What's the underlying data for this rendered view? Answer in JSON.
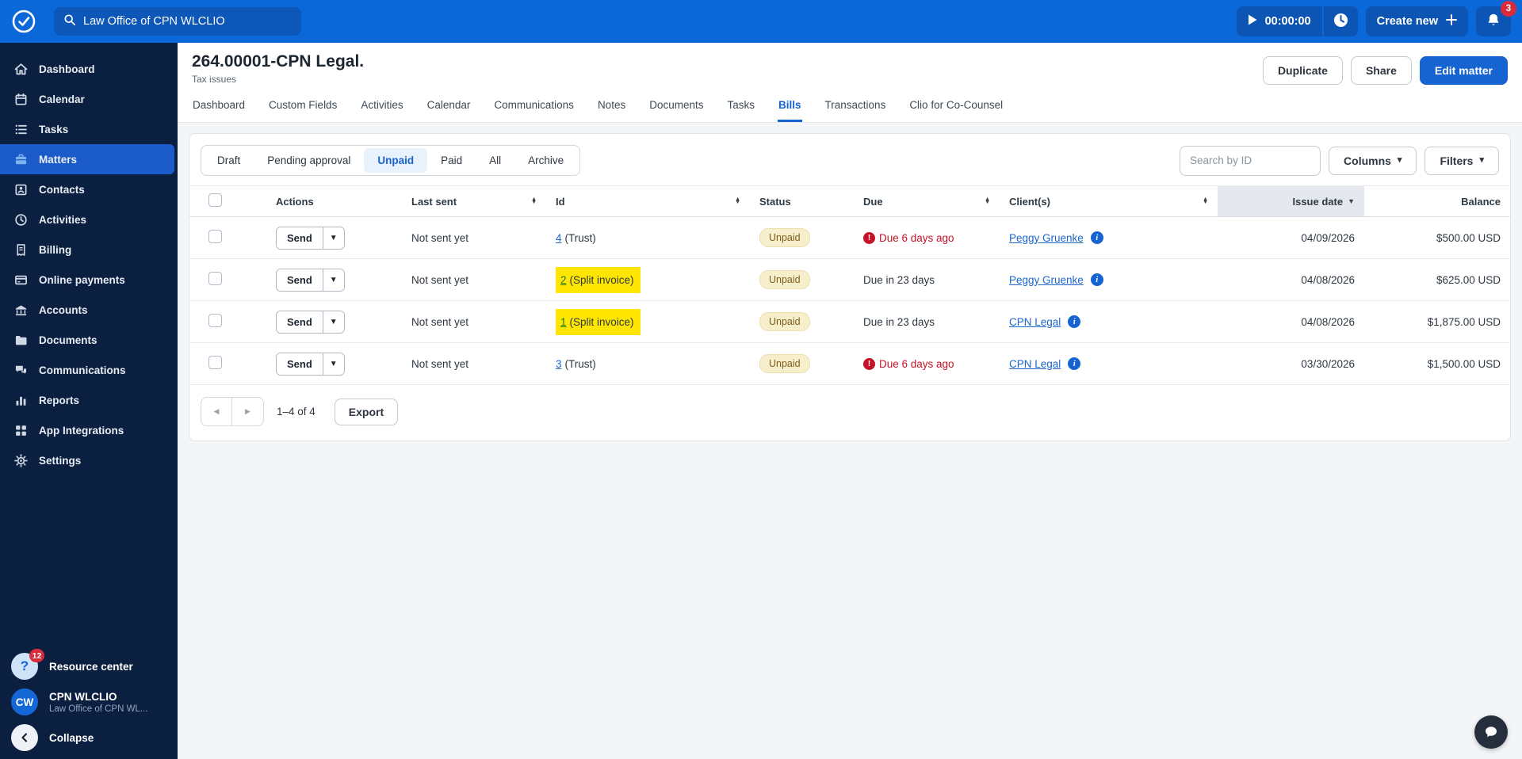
{
  "topbar": {
    "search_value": "Law Office of CPN WLCLIO",
    "timer": "00:00:00",
    "create_new_label": "Create new",
    "notification_count": "3"
  },
  "sidebar": {
    "items": [
      {
        "label": "Dashboard",
        "icon": "home-icon",
        "active": false
      },
      {
        "label": "Calendar",
        "icon": "calendar-icon",
        "active": false
      },
      {
        "label": "Tasks",
        "icon": "tasks-icon",
        "active": false
      },
      {
        "label": "Matters",
        "icon": "briefcase-icon",
        "active": true
      },
      {
        "label": "Contacts",
        "icon": "contact-card-icon",
        "active": false
      },
      {
        "label": "Activities",
        "icon": "clock-icon",
        "active": false
      },
      {
        "label": "Billing",
        "icon": "receipt-icon",
        "active": false
      },
      {
        "label": "Online payments",
        "icon": "credit-card-icon",
        "active": false
      },
      {
        "label": "Accounts",
        "icon": "bank-icon",
        "active": false
      },
      {
        "label": "Documents",
        "icon": "folder-icon",
        "active": false
      },
      {
        "label": "Communications",
        "icon": "chat-bubbles-icon",
        "active": false
      },
      {
        "label": "Reports",
        "icon": "bar-chart-icon",
        "active": false
      },
      {
        "label": "App Integrations",
        "icon": "apps-grid-icon",
        "active": false
      },
      {
        "label": "Settings",
        "icon": "gear-icon",
        "active": false
      }
    ],
    "resource_center": {
      "label": "Resource center",
      "badge": "12"
    },
    "user": {
      "initials": "CW",
      "name": "CPN WLCLIO",
      "org": "Law Office of CPN WL..."
    },
    "collapse_label": "Collapse"
  },
  "matter_header": {
    "title": "264.00001-CPN Legal.",
    "subtitle": "Tax issues",
    "duplicate_label": "Duplicate",
    "share_label": "Share",
    "edit_label": "Edit matter"
  },
  "tabs": [
    {
      "label": "Dashboard",
      "active": false
    },
    {
      "label": "Custom Fields",
      "active": false
    },
    {
      "label": "Activities",
      "active": false
    },
    {
      "label": "Calendar",
      "active": false
    },
    {
      "label": "Communications",
      "active": false
    },
    {
      "label": "Notes",
      "active": false
    },
    {
      "label": "Documents",
      "active": false
    },
    {
      "label": "Tasks",
      "active": false
    },
    {
      "label": "Bills",
      "active": true
    },
    {
      "label": "Transactions",
      "active": false
    },
    {
      "label": "Clio for Co-Counsel",
      "active": false
    }
  ],
  "bills": {
    "filters": [
      "Draft",
      "Pending approval",
      "Unpaid",
      "Paid",
      "All",
      "Archive"
    ],
    "active_filter": "Unpaid",
    "search_placeholder": "Search by ID",
    "columns_label": "Columns",
    "filters_label": "Filters",
    "table": {
      "headers": [
        "Actions",
        "Last sent",
        "Id",
        "Status",
        "Due",
        "Client(s)",
        "Issue date",
        "Balance"
      ],
      "sorted_column": "Issue date",
      "rows": [
        {
          "action": "Send",
          "last_sent": "Not sent yet",
          "id_link": "4",
          "id_suffix": "(Trust)",
          "highlighted": false,
          "status": "Unpaid",
          "due": "Due 6 days ago",
          "overdue": true,
          "client": "Peggy Gruenke",
          "issue_date": "04/09/2026",
          "balance": "$500.00 USD"
        },
        {
          "action": "Send",
          "last_sent": "Not sent yet",
          "id_link": "2",
          "id_suffix": "(Split invoice)",
          "highlighted": true,
          "status": "Unpaid",
          "due": "Due in 23 days",
          "overdue": false,
          "client": "Peggy Gruenke",
          "issue_date": "04/08/2026",
          "balance": "$625.00 USD"
        },
        {
          "action": "Send",
          "last_sent": "Not sent yet",
          "id_link": "1",
          "id_suffix": "(Split invoice)",
          "highlighted": true,
          "status": "Unpaid",
          "due": "Due in 23 days",
          "overdue": false,
          "client": "CPN Legal",
          "issue_date": "04/08/2026",
          "balance": "$1,875.00 USD"
        },
        {
          "action": "Send",
          "last_sent": "Not sent yet",
          "id_link": "3",
          "id_suffix": "(Trust)",
          "highlighted": false,
          "status": "Unpaid",
          "due": "Due 6 days ago",
          "overdue": true,
          "client": "CPN Legal",
          "issue_date": "03/30/2026",
          "balance": "$1,500.00 USD"
        }
      ]
    },
    "pagination": {
      "range": "1–4 of 4",
      "export_label": "Export"
    }
  },
  "colors": {
    "topbar_blue": "#0b68d9",
    "sidebar_navy": "#0b2040",
    "accent_blue": "#1663d2",
    "highlight_yellow": "#ffe600",
    "overdue_red": "#c41226",
    "unpaid_badge_bg": "#f7eecb",
    "unpaid_badge_text": "#7d5d1b"
  }
}
